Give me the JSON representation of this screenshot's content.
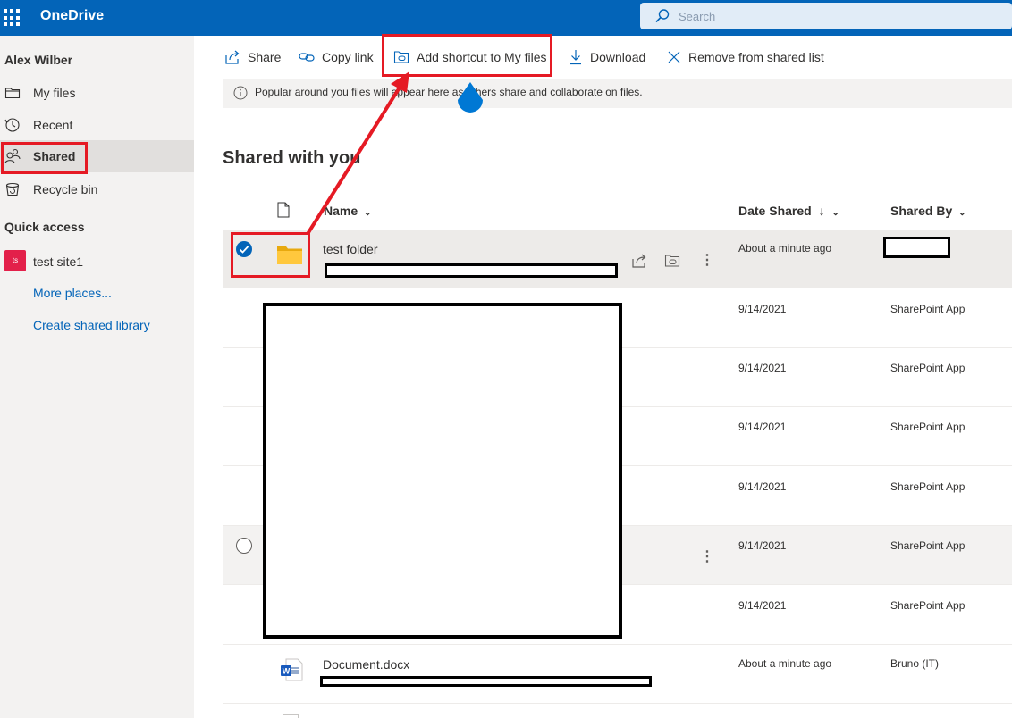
{
  "app": {
    "name": "OneDrive"
  },
  "search": {
    "placeholder": "Search"
  },
  "sidebar": {
    "user": "Alex Wilber",
    "items": [
      {
        "label": "My files",
        "icon": "folder-icon"
      },
      {
        "label": "Recent",
        "icon": "clock-icon"
      },
      {
        "label": "Shared",
        "icon": "people-icon",
        "selected": true
      },
      {
        "label": "Recycle bin",
        "icon": "recycle-bin-icon"
      }
    ],
    "quick_access_label": "Quick access",
    "site": {
      "badge": "ts",
      "label": "test site1"
    },
    "more_places": "More places...",
    "create_library": "Create shared library"
  },
  "toolbar": {
    "share": "Share",
    "copy_link": "Copy link",
    "add_shortcut": "Add shortcut to My files",
    "download": "Download",
    "remove": "Remove from shared list"
  },
  "banner": {
    "text": "Popular around you files will appear here as others share and collaborate on files."
  },
  "page": {
    "title": "Shared with you"
  },
  "columns": {
    "name": "Name",
    "date": "Date Shared",
    "by": "Shared By"
  },
  "rows": [
    {
      "name": "test folder",
      "date": "About a minute ago",
      "by": "",
      "type": "folder",
      "selected": true
    },
    {
      "name": "",
      "date": "9/14/2021",
      "by": "SharePoint App"
    },
    {
      "name": "",
      "date": "9/14/2021",
      "by": "SharePoint App"
    },
    {
      "name": "",
      "date": "9/14/2021",
      "by": "SharePoint App"
    },
    {
      "name": "",
      "date": "9/14/2021",
      "by": "SharePoint App"
    },
    {
      "name": "",
      "date": "9/14/2021",
      "by": "SharePoint App",
      "hover": true
    },
    {
      "name": "",
      "date": "9/14/2021",
      "by": "SharePoint App"
    },
    {
      "name": "Document.docx",
      "date": "About a minute ago",
      "by": "Bruno (IT)",
      "type": "word"
    }
  ],
  "colors": {
    "brand": "#0364b8",
    "annotation": "#e51a24",
    "site_badge": "#e3204a"
  }
}
